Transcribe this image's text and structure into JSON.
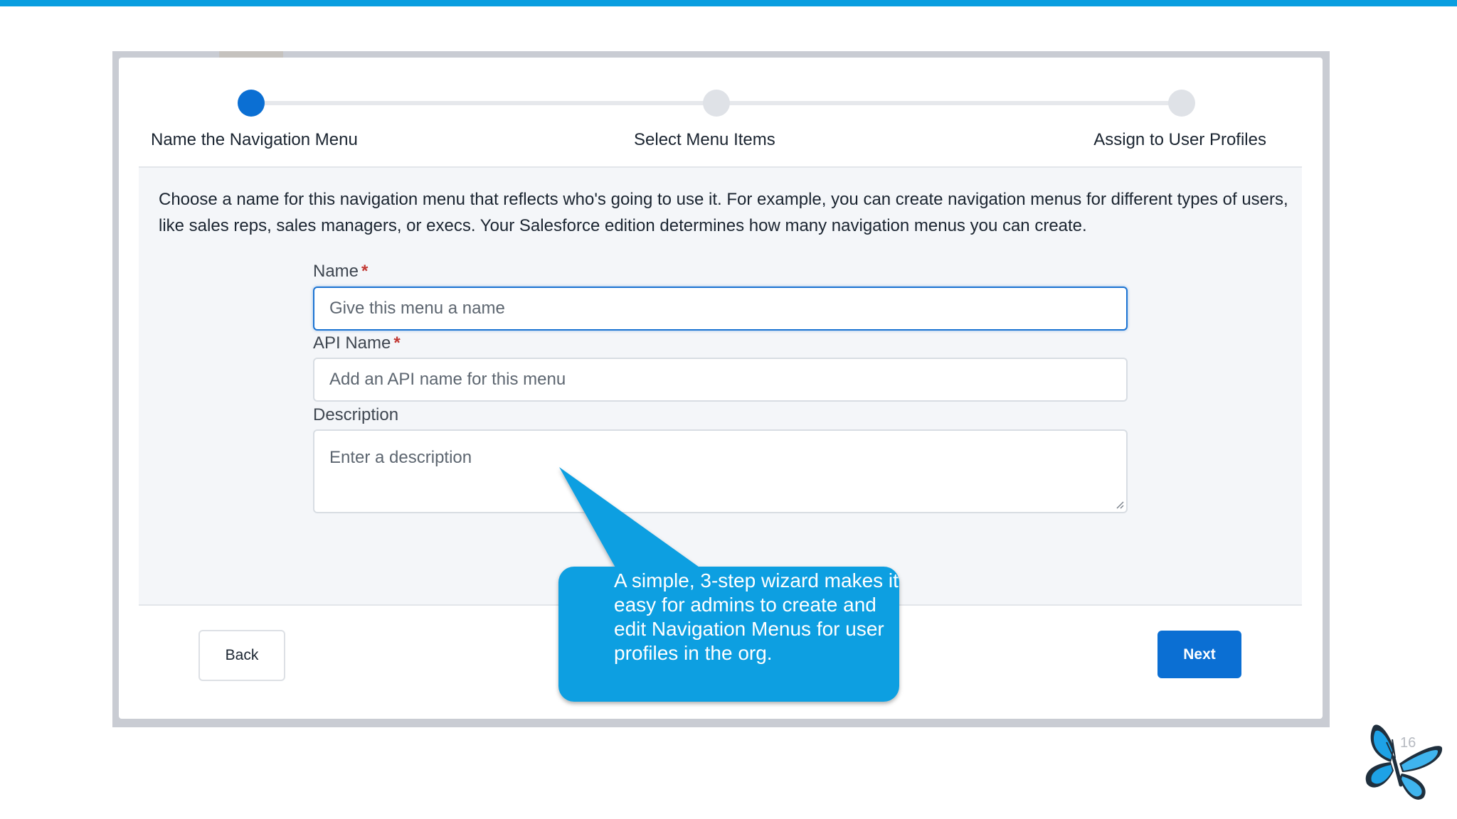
{
  "wizard": {
    "steps": [
      {
        "label": "Name the Navigation Menu",
        "active": true
      },
      {
        "label": "Select Menu Items",
        "active": false
      },
      {
        "label": "Assign to User Profiles",
        "active": false
      }
    ],
    "intro": "Choose a name for this navigation menu that reflects who's going to use it. For example, you can create navigation menus for different types of users, like sales reps, sales managers, or execs. Your Salesforce edition determines how many navigation menus you can create.",
    "fields": {
      "name": {
        "label": "Name",
        "required_mark": "*",
        "placeholder": "Give this menu a name",
        "value": ""
      },
      "api_name": {
        "label": "API Name",
        "required_mark": "*",
        "placeholder": "Add an API name for this menu",
        "value": ""
      },
      "description": {
        "label": "Description",
        "placeholder": "Enter a description",
        "value": ""
      }
    },
    "buttons": {
      "back": "Back",
      "next": "Next"
    }
  },
  "callout": {
    "text": "A simple, 3-step wizard makes it easy for admins to create and edit Navigation Menus for user profiles in the org."
  },
  "slide": {
    "page_number": "16"
  },
  "colors": {
    "accent_bar": "#0a9ee0",
    "active_step": "#0b6fd3",
    "primary_button": "#0b6fd3",
    "callout": "#0b9fe1",
    "required": "#c23934"
  }
}
